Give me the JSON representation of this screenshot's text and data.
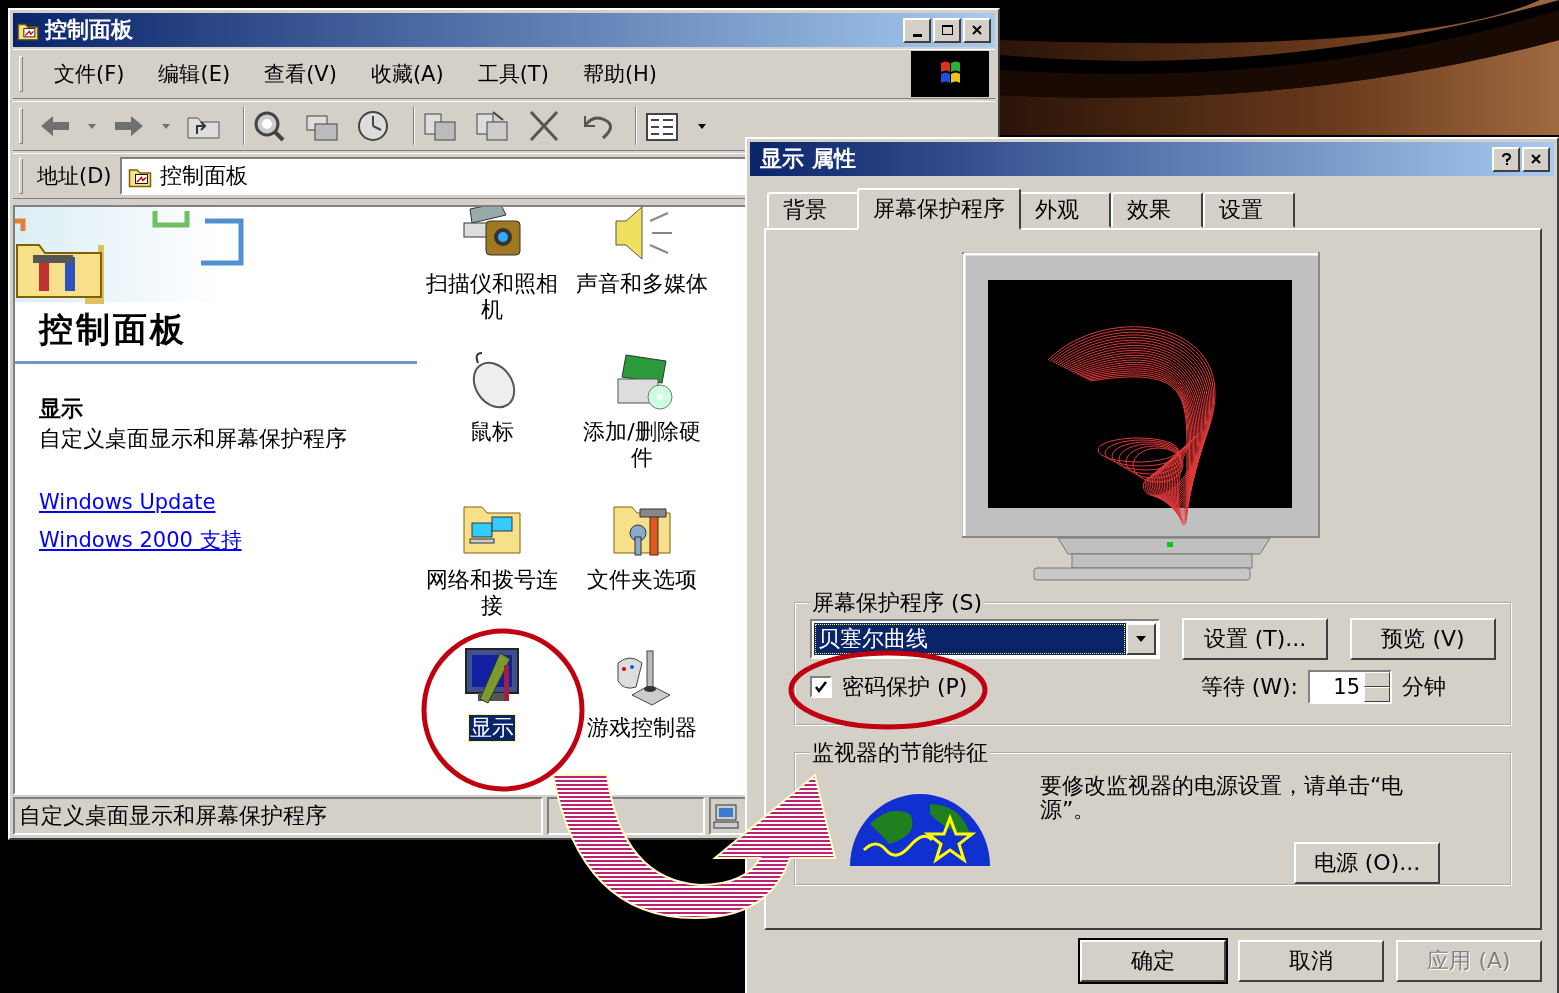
{
  "explorer": {
    "title": "控制面板",
    "menu": [
      "文件(F)",
      "编辑(E)",
      "查看(V)",
      "收藏(A)",
      "工具(T)",
      "帮助(H)"
    ],
    "address_label": "地址(D)",
    "address": "控制面板",
    "panel_title": "控制面板",
    "detail_title": "显示",
    "detail_text": "自定义桌面显示和屏幕保护程序",
    "links": [
      "Windows Update",
      "Windows 2000 支持"
    ],
    "items": [
      {
        "label": "扫描仪和照相机",
        "selected": false
      },
      {
        "label": "声音和多媒体",
        "selected": false
      },
      {
        "label": "鼠标",
        "selected": false
      },
      {
        "label": "添加/删除硬件",
        "selected": false
      },
      {
        "label": "网络和拨号连接",
        "selected": false
      },
      {
        "label": "文件夹选项",
        "selected": false
      },
      {
        "label": "显示",
        "selected": true
      },
      {
        "label": "游戏控制器",
        "selected": false
      }
    ],
    "status": "自定义桌面显示和屏幕保护程序"
  },
  "dialog": {
    "title": "显示 属性",
    "tabs": [
      {
        "label": "背景",
        "selected": false
      },
      {
        "label": "屏幕保护程序",
        "selected": true
      },
      {
        "label": "外观",
        "selected": false
      },
      {
        "label": "效果",
        "selected": false
      },
      {
        "label": "设置",
        "selected": false
      }
    ],
    "screensaver_group": "屏幕保护程序 (S)",
    "screensaver": "贝塞尔曲线",
    "settings_button": "设置 (T)...",
    "preview_button": "预览 (V)",
    "password": {
      "label": "密码保护 (P)",
      "checked": true
    },
    "wait_label": "等待 (W):",
    "wait": "15",
    "wait_unit": "分钟",
    "energy_group": "监视器的节能特征",
    "energy_text": "要修改监视器的电源设置，请单击“电源”。",
    "power_button": "电源 (O)...",
    "buttons": [
      {
        "label": "确定",
        "disabled": false
      },
      {
        "label": "取消",
        "disabled": false
      },
      {
        "label": "应用 (A)",
        "disabled": true
      }
    ]
  }
}
